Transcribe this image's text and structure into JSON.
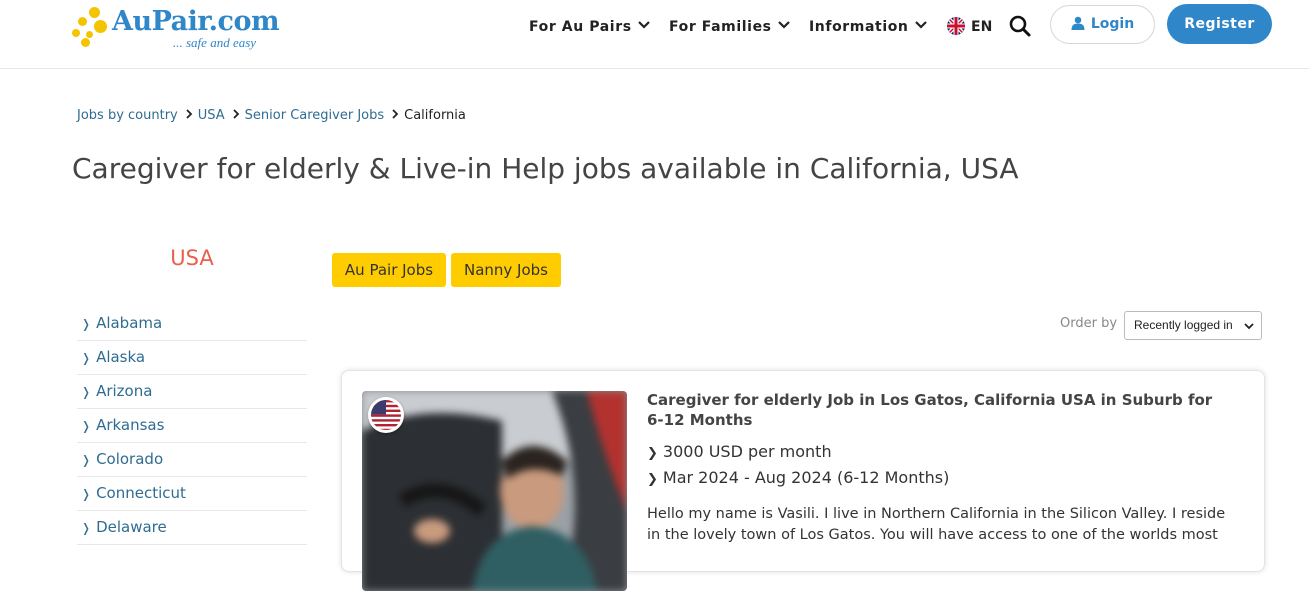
{
  "header": {
    "logo_name": "AuPair.com",
    "logo_tagline": "... safe and easy",
    "nav": [
      {
        "label": "For Au Pairs"
      },
      {
        "label": "For Families"
      },
      {
        "label": "Information"
      }
    ],
    "language": "EN",
    "login_label": "Login",
    "register_label": "Register"
  },
  "breadcrumb": [
    "Jobs by country",
    "USA",
    "Senior Caregiver Jobs",
    "California"
  ],
  "page_title": "Caregiver for elderly & Live-in Help jobs available in California, USA",
  "sidebar": {
    "title": "USA",
    "states": [
      "Alabama",
      "Alaska",
      "Arizona",
      "Arkansas",
      "Colorado",
      "Connecticut",
      "Delaware"
    ]
  },
  "filters": {
    "tags": [
      "Au Pair Jobs",
      "Nanny Jobs"
    ],
    "order_label": "Order by",
    "order_value": "Recently logged in"
  },
  "listing": {
    "title": "Caregiver for elderly Job in Los Gatos, California USA in Suburb for 6-12 Months",
    "salary": "3000 USD per month",
    "period": "Mar 2024 - Aug 2024 (6-12 Months)",
    "description": "Hello my name is Vasili. I live in Northern California in the Silicon Valley. I reside in the lovely town of Los Gatos. You will have access to one of the worlds most"
  },
  "colors": {
    "brand_blue": "#2f86c8",
    "link_blue": "#2f6c91",
    "tag_yellow": "#ffcc00",
    "sidebar_title": "#e8604c"
  },
  "icons": [
    "logo-dots-icon",
    "chevron-down-icon",
    "uk-flag-icon",
    "search-icon",
    "user-icon",
    "arrow-right-icon",
    "us-flag-icon"
  ]
}
